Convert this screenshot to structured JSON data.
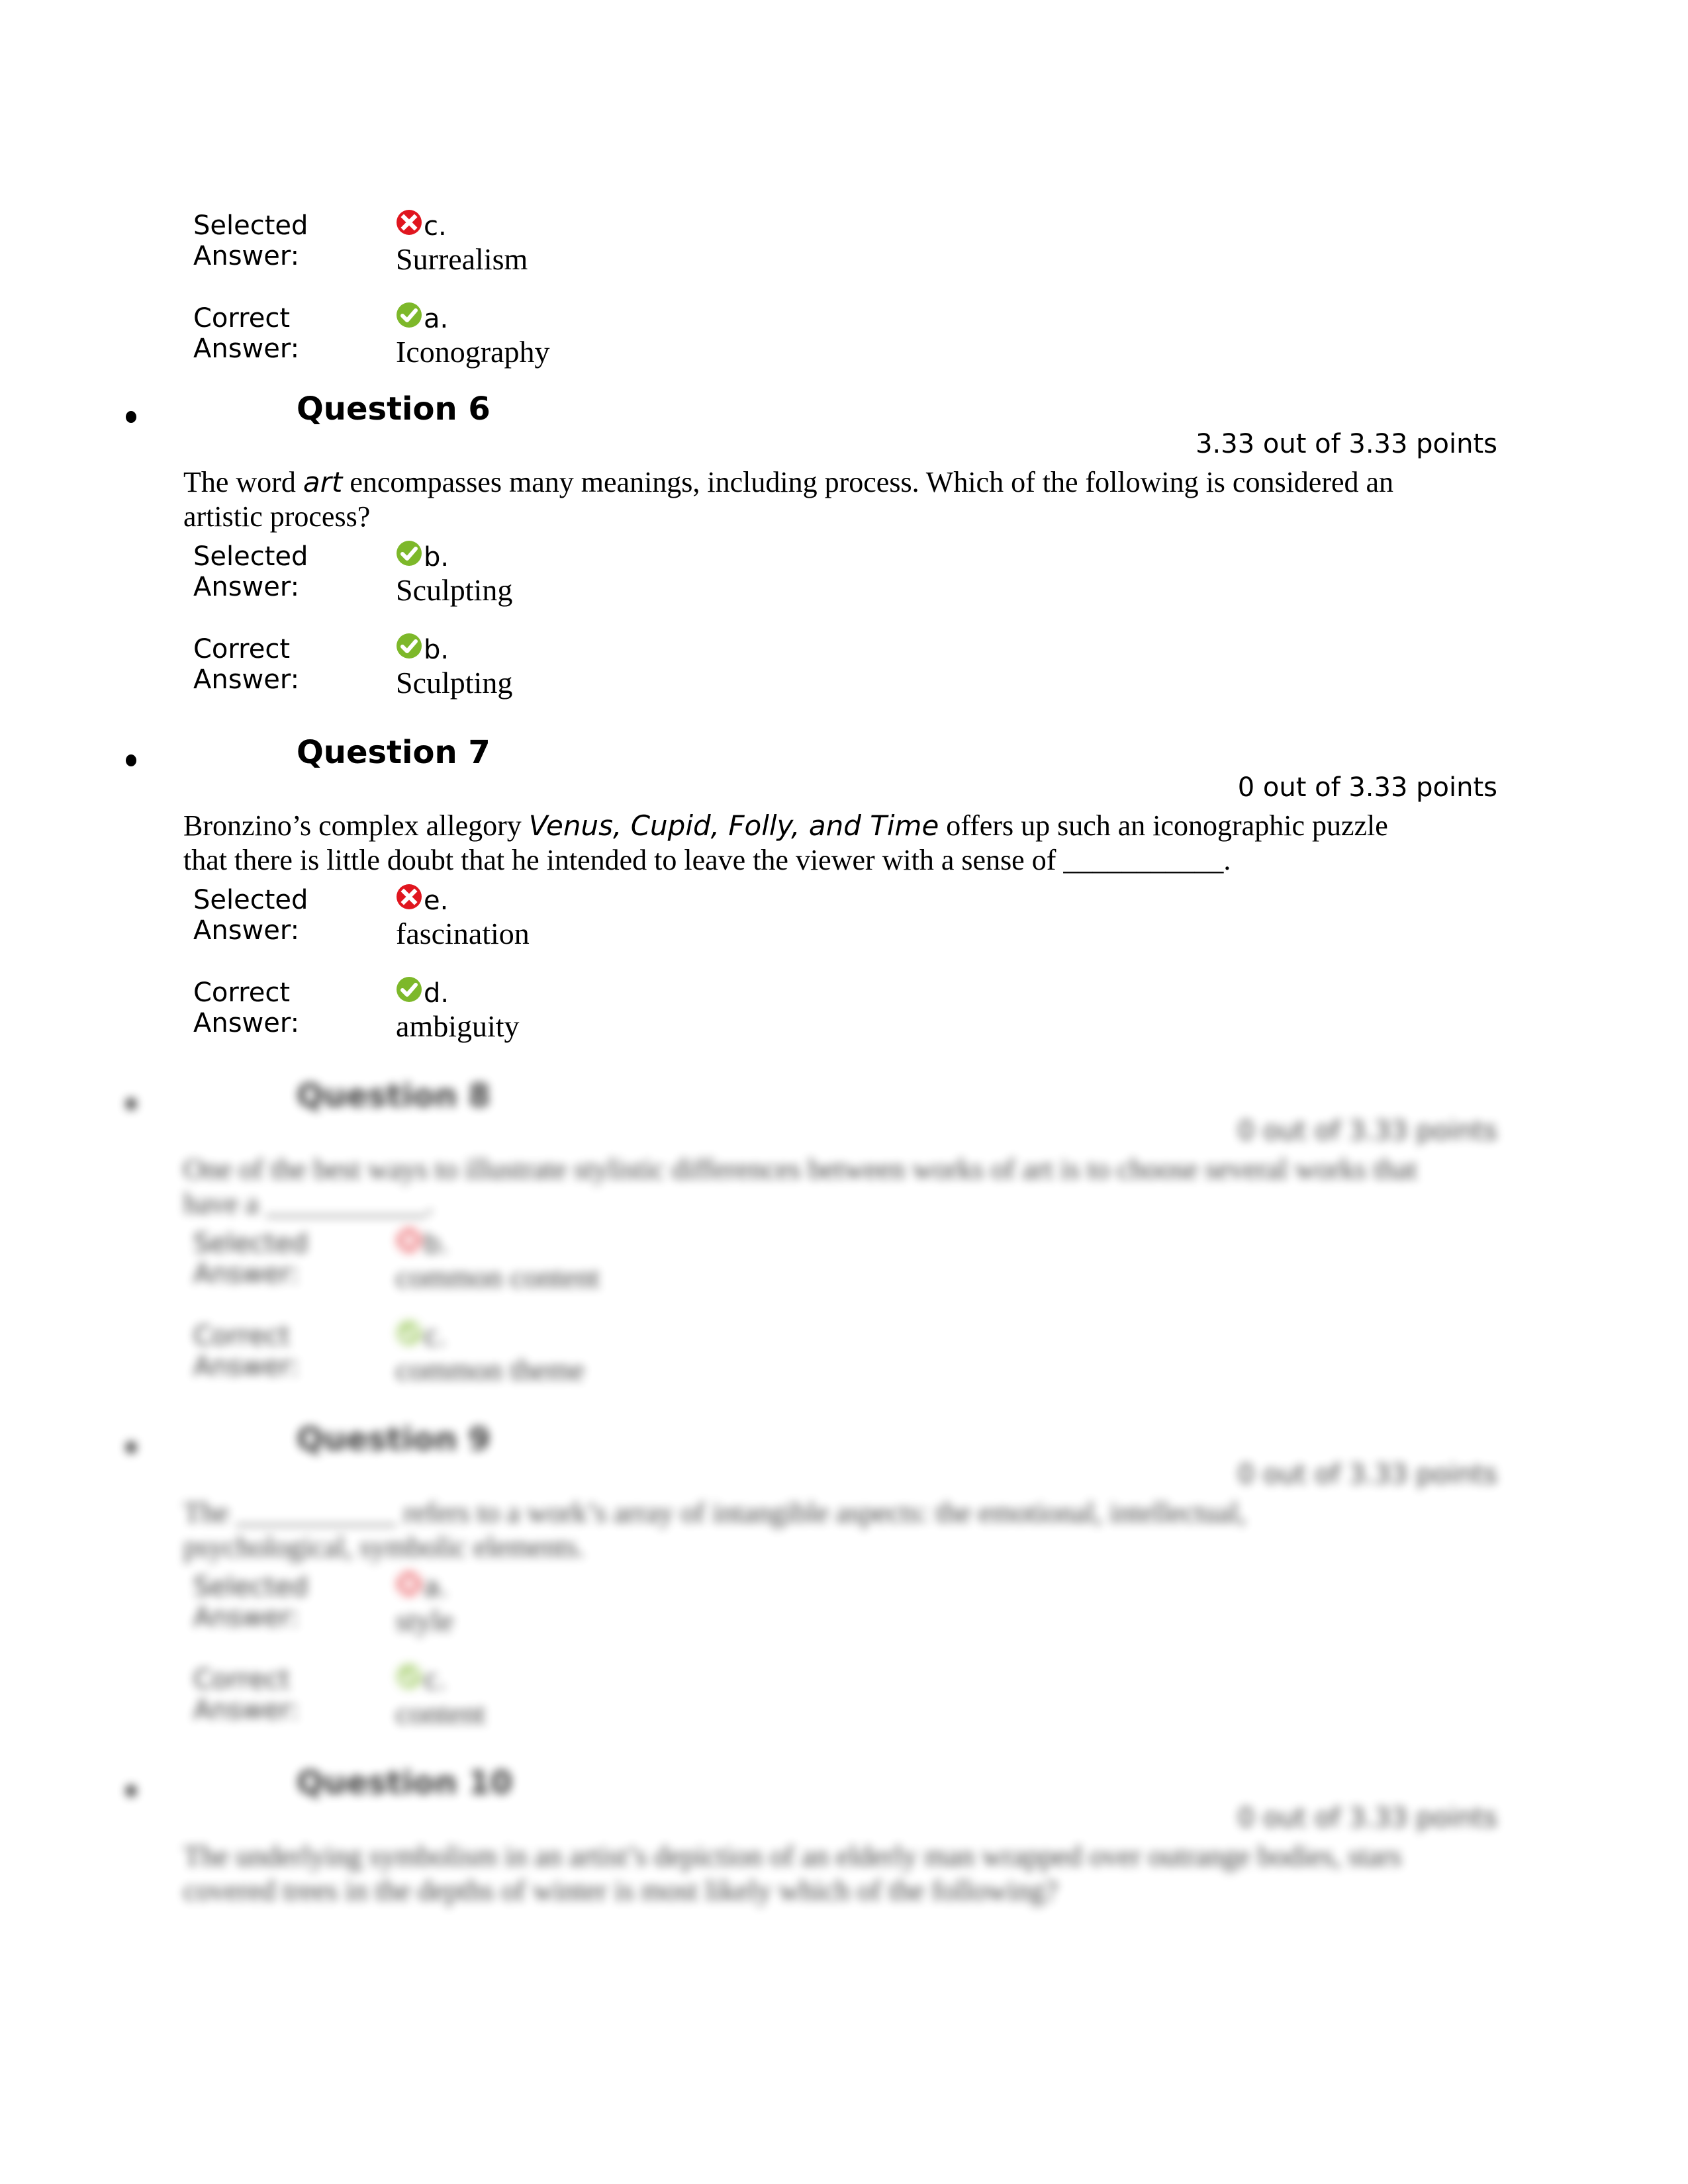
{
  "previous_question_tail": {
    "selected_label_line1": "Selected",
    "selected_label_line2": "Answer:",
    "selected_letter": "c.",
    "selected_text": "Surrealism",
    "selected_status": "incorrect",
    "correct_label_line1": "Correct",
    "correct_label_line2": "Answer:",
    "correct_letter": "a.",
    "correct_text": "Iconography",
    "correct_status": "correct"
  },
  "questions": [
    {
      "bullet": "•",
      "title": "Question 6",
      "points": "3.33 out of 3.33 points",
      "text_before": "The word ",
      "text_italic": "art",
      "text_after": " encompasses many meanings, including process. Which of the following is considered an artistic process?",
      "selected_label_line1": "Selected",
      "selected_label_line2": "Answer:",
      "selected_letter": "b.",
      "selected_text": "Sculpting",
      "selected_status": "correct",
      "correct_label_line1": "Correct",
      "correct_label_line2": "Answer:",
      "correct_letter": "b.",
      "correct_text": "Sculpting",
      "correct_status": "correct",
      "blurred": false
    },
    {
      "bullet": "•",
      "title": "Question 7",
      "points": "0 out of 3.33 points",
      "text_before": "Bronzino’s complex allegory ",
      "text_italic": "Venus, Cupid, Folly, and Time",
      "text_after": " offers up such an iconographic puzzle that there is little doubt that he intended to leave the viewer with a sense of ___________.",
      "selected_label_line1": "Selected",
      "selected_label_line2": "Answer:",
      "selected_letter": "e.",
      "selected_text": "fascination",
      "selected_status": "incorrect",
      "correct_label_line1": "Correct",
      "correct_label_line2": "Answer:",
      "correct_letter": "d.",
      "correct_text": "ambiguity",
      "correct_status": "correct",
      "blurred": false
    },
    {
      "bullet": "•",
      "title": "Question 8",
      "points": "0 out of 3.33 points",
      "text_before": "One of the best ways to illustrate stylistic differences between works of art is to choose several works that have a ___________.",
      "text_italic": "",
      "text_after": "",
      "selected_label_line1": "Selected",
      "selected_label_line2": "Answer:",
      "selected_letter": "b.",
      "selected_text": "common content",
      "selected_status": "incorrect",
      "correct_label_line1": "Correct",
      "correct_label_line2": "Answer:",
      "correct_letter": "c.",
      "correct_text": "common theme",
      "correct_status": "correct",
      "blurred": true
    },
    {
      "bullet": "•",
      "title": "Question 9",
      "points": "0 out of 3.33 points",
      "text_before": "The ___________ refers to a work’s array of intangible aspects: the emotional, intellectual, psychological, symbolic elements.",
      "text_italic": "",
      "text_after": "",
      "selected_label_line1": "Selected",
      "selected_label_line2": "Answer:",
      "selected_letter": "a.",
      "selected_text": "style",
      "selected_status": "incorrect",
      "correct_label_line1": "Correct",
      "correct_label_line2": "Answer:",
      "correct_letter": "c.",
      "correct_text": "content",
      "correct_status": "correct",
      "blurred": true
    },
    {
      "bullet": "•",
      "title": "Question 10",
      "points": "0 out of 3.33 points",
      "text_before": "The underlying symbolism in an artist’s depiction of an elderly man wrapped over outrange bodies, stars covered trees in the depths of winter is most likely which of the following?",
      "text_italic": "",
      "text_after": "",
      "blurred": true
    }
  ],
  "colors": {
    "incorrect_icon": "#e0161f",
    "correct_icon": "#7db82a",
    "text": "#000000"
  },
  "icons": {
    "incorrect": "x-circle-icon",
    "correct": "check-circle-icon"
  }
}
